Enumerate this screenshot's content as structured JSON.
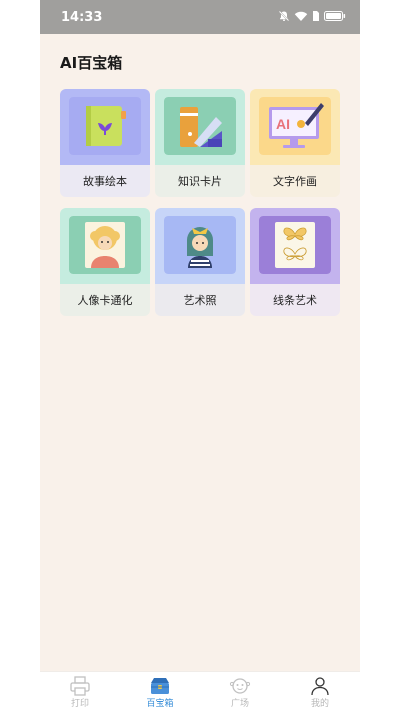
{
  "status_bar": {
    "time": "14:33"
  },
  "page": {
    "title": "AI百宝箱"
  },
  "tools": [
    {
      "label": "故事绘本",
      "icon": "storybook-icon",
      "top_color": "#b3b9f5",
      "bottom_color": "#ebe9f3"
    },
    {
      "label": "知识卡片",
      "icon": "knowledge-card-icon",
      "top_color": "#c5ecdf",
      "bottom_color": "#ebefe8"
    },
    {
      "label": "文字作画",
      "icon": "text-to-image-icon",
      "top_color": "#fbe8b4",
      "bottom_color": "#f7efe0"
    },
    {
      "label": "人像卡通化",
      "icon": "portrait-cartoon-icon",
      "top_color": "#c5ecdf",
      "bottom_color": "#ebefe8"
    },
    {
      "label": "艺术照",
      "icon": "art-photo-icon",
      "top_color": "#c7d5f8",
      "bottom_color": "#ebeaee"
    },
    {
      "label": "线条艺术",
      "icon": "line-art-icon",
      "top_color": "#c3b3ee",
      "bottom_color": "#efe8f2"
    }
  ],
  "tab_bar": {
    "items": [
      {
        "label": "打印",
        "icon": "printer-icon",
        "active": false
      },
      {
        "label": "百宝箱",
        "icon": "treasure-box-icon",
        "active": true
      },
      {
        "label": "广场",
        "icon": "plaza-icon",
        "active": false
      },
      {
        "label": "我的",
        "icon": "profile-icon",
        "active": false
      }
    ]
  }
}
